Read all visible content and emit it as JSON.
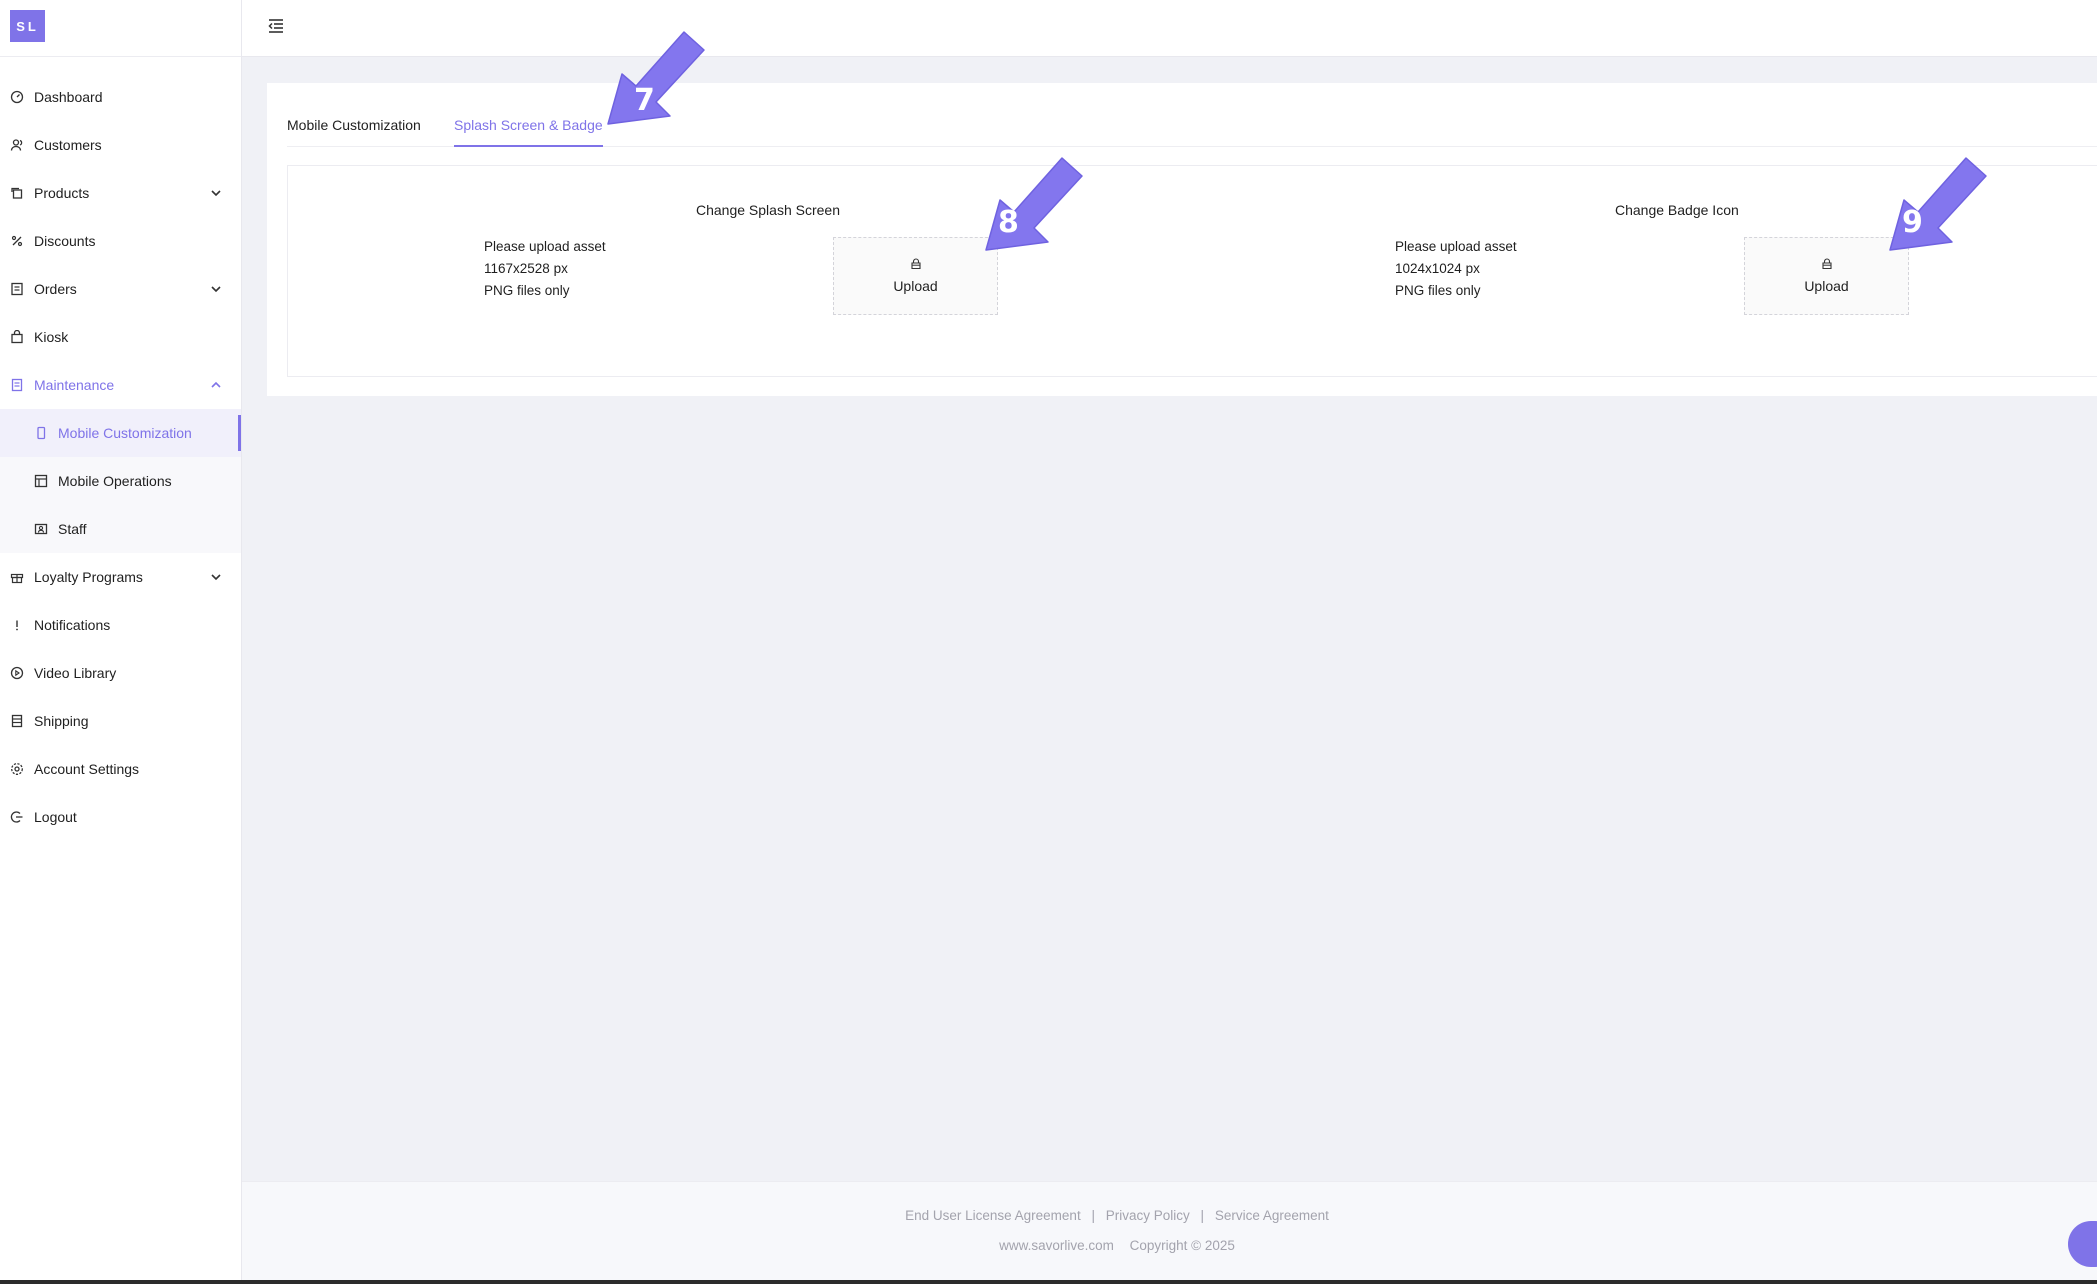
{
  "app": {
    "logo_text": "SL"
  },
  "sidebar": {
    "items": [
      {
        "label": "Dashboard"
      },
      {
        "label": "Customers"
      },
      {
        "label": "Products"
      },
      {
        "label": "Discounts"
      },
      {
        "label": "Orders"
      },
      {
        "label": "Kiosk"
      },
      {
        "label": "Maintenance"
      },
      {
        "label": "Loyalty Programs"
      },
      {
        "label": "Notifications"
      },
      {
        "label": "Video Library"
      },
      {
        "label": "Shipping"
      },
      {
        "label": "Account Settings"
      },
      {
        "label": "Logout"
      }
    ],
    "maintenance_sub": [
      {
        "label": "Mobile Customization"
      },
      {
        "label": "Mobile Operations"
      },
      {
        "label": "Staff"
      }
    ]
  },
  "tabs": [
    {
      "label": "Mobile Customization"
    },
    {
      "label": "Splash Screen & Badge"
    }
  ],
  "splash": {
    "title": "Change Splash Screen",
    "line1": "Please upload asset",
    "line2": "1167x2528 px",
    "line3": "PNG files only",
    "upload_label": "Upload"
  },
  "badge": {
    "title": "Change Badge Icon",
    "line1": "Please upload asset",
    "line2": "1024x1024 px",
    "line3": "PNG files only",
    "upload_label": "Upload"
  },
  "annotations": {
    "a7": "7",
    "a8": "8",
    "a9": "9"
  },
  "footer": {
    "eula": "End User License Agreement",
    "privacy": "Privacy Policy",
    "service": "Service Agreement",
    "separator": "|",
    "site": "www.savorlive.com",
    "copyright": "Copyright © 2025"
  },
  "colors": {
    "accent": "#7f73e8",
    "arrow": "#8376ee"
  }
}
